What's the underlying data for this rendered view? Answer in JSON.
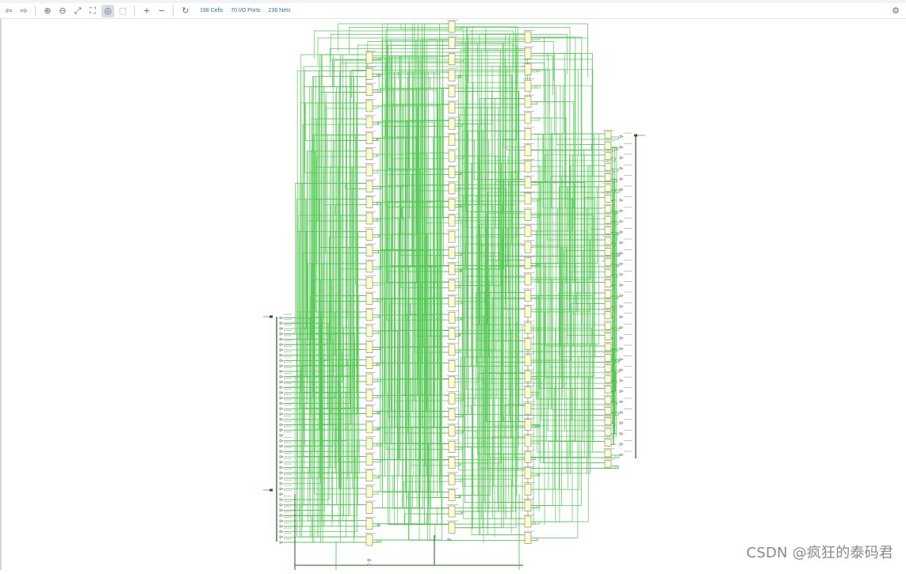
{
  "toolbar": {
    "buttons": [
      {
        "name": "back-button",
        "icon": "arrow-left-icon",
        "glyph": "⇦",
        "dim": true
      },
      {
        "name": "forward-button",
        "icon": "arrow-right-icon",
        "glyph": "⇨",
        "dim": true
      },
      {
        "name": "zoom-in-button",
        "icon": "zoom-in-icon",
        "glyph": "⊕"
      },
      {
        "name": "zoom-out-button",
        "icon": "zoom-out-icon",
        "glyph": "⊖"
      },
      {
        "name": "zoom-fit-button",
        "icon": "zoom-fit-icon",
        "glyph": "⤢"
      },
      {
        "name": "zoom-area-button",
        "icon": "zoom-area-icon",
        "glyph": "⛶"
      },
      {
        "name": "auto-fit-button",
        "icon": "auto-fit-icon",
        "glyph": "◎",
        "active": true
      },
      {
        "name": "regenerate-button",
        "icon": "regenerate-icon",
        "glyph": "▢",
        "dim": true
      },
      {
        "name": "expand-button",
        "icon": "plus-icon",
        "glyph": "+"
      },
      {
        "name": "collapse-button",
        "icon": "minus-icon",
        "glyph": "−"
      },
      {
        "name": "reload-button",
        "icon": "reload-icon",
        "glyph": "↻"
      }
    ],
    "stats": {
      "cells": "198 Cells",
      "io_ports": "70 I/O Ports",
      "nets": "236 Nets"
    },
    "settings_icon": "gear-icon"
  },
  "schematic": {
    "wire_color": "#44c444",
    "cell_fill": "#ffffcc",
    "cell_border": "#7a7a7a",
    "bus_color": "#1d5f1d",
    "columns": [
      {
        "name": "column-1-cells",
        "count": 31,
        "kind": "cell"
      },
      {
        "name": "column-2-cells",
        "count": 32,
        "kind": "cell"
      },
      {
        "name": "column-3-cells",
        "count": 32,
        "kind": "cell"
      },
      {
        "name": "column-4-cells",
        "count": 32,
        "kind": "cell"
      },
      {
        "name": "input-buffers",
        "count": 43,
        "kind": "ibuf"
      },
      {
        "name": "output-buffers",
        "count": 31,
        "kind": "obuf"
      }
    ]
  },
  "watermark": "CSDN @疯狂的泰码君"
}
